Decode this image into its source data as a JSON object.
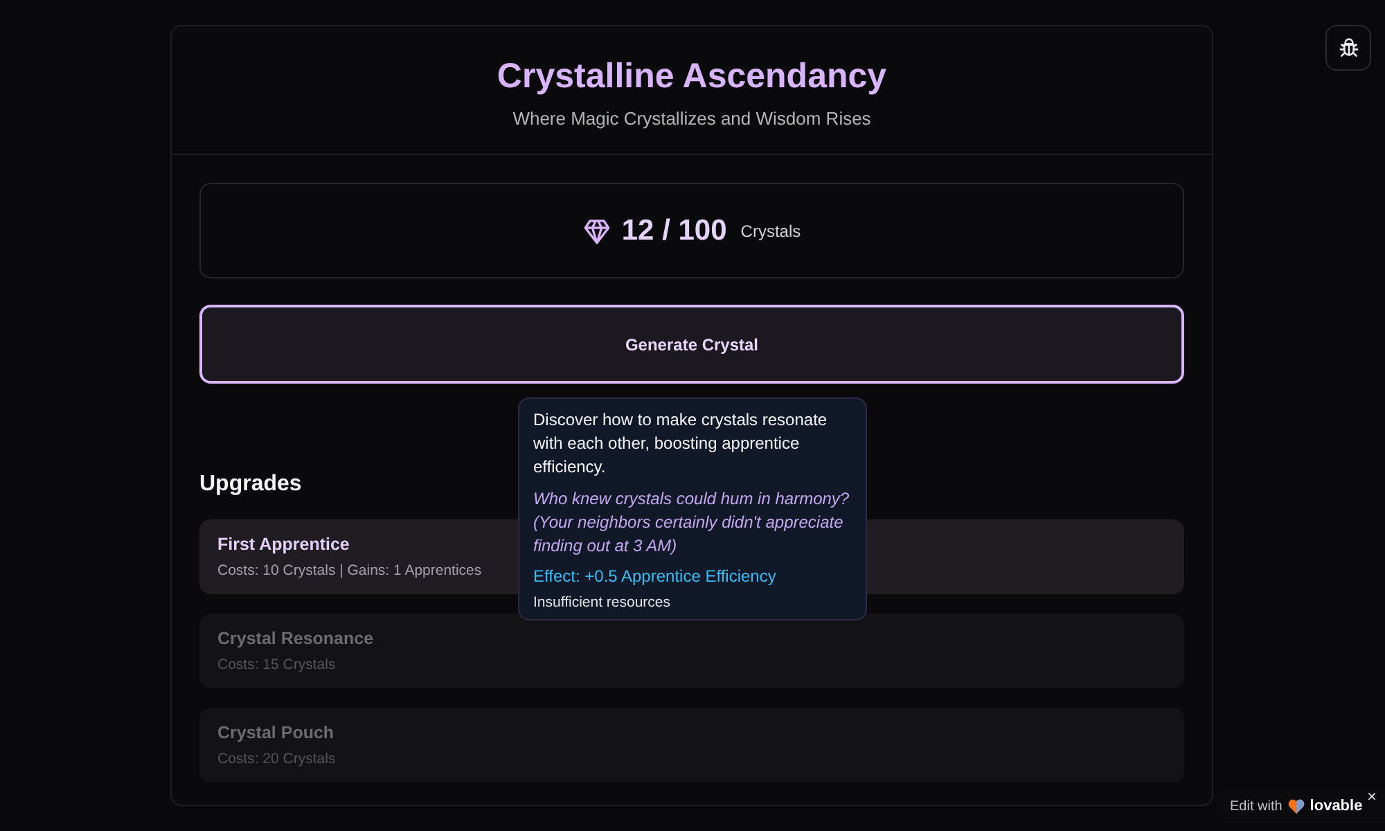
{
  "header": {
    "title": "Crystalline Ascendancy",
    "subtitle": "Where Magic Crystallizes and Wisdom Rises"
  },
  "resources": {
    "amount": "12 / 100",
    "unit": "Crystals"
  },
  "generate_button": "Generate Crystal",
  "upgrades": {
    "heading": "Upgrades",
    "items": [
      {
        "name": "First Apprentice",
        "details": "Costs: 10 Crystals | Gains: 1 Apprentices",
        "disabled": false
      },
      {
        "name": "Crystal Resonance",
        "details": "Costs: 15 Crystals",
        "disabled": true
      },
      {
        "name": "Crystal Pouch",
        "details": "Costs: 20 Crystals",
        "disabled": true
      }
    ]
  },
  "tooltip": {
    "description": "Discover how to make crystals resonate with each other, boosting apprentice efficiency.",
    "flavor": "Who knew crystals could hum in harmony? (Your neighbors certainly didn't appreciate finding out at 3 AM)",
    "effect": "Effect: +0.5 Apprentice Efficiency",
    "status": "Insufficient resources"
  },
  "badge": {
    "prefix": "Edit with",
    "brand": "lovable",
    "close": "×"
  }
}
